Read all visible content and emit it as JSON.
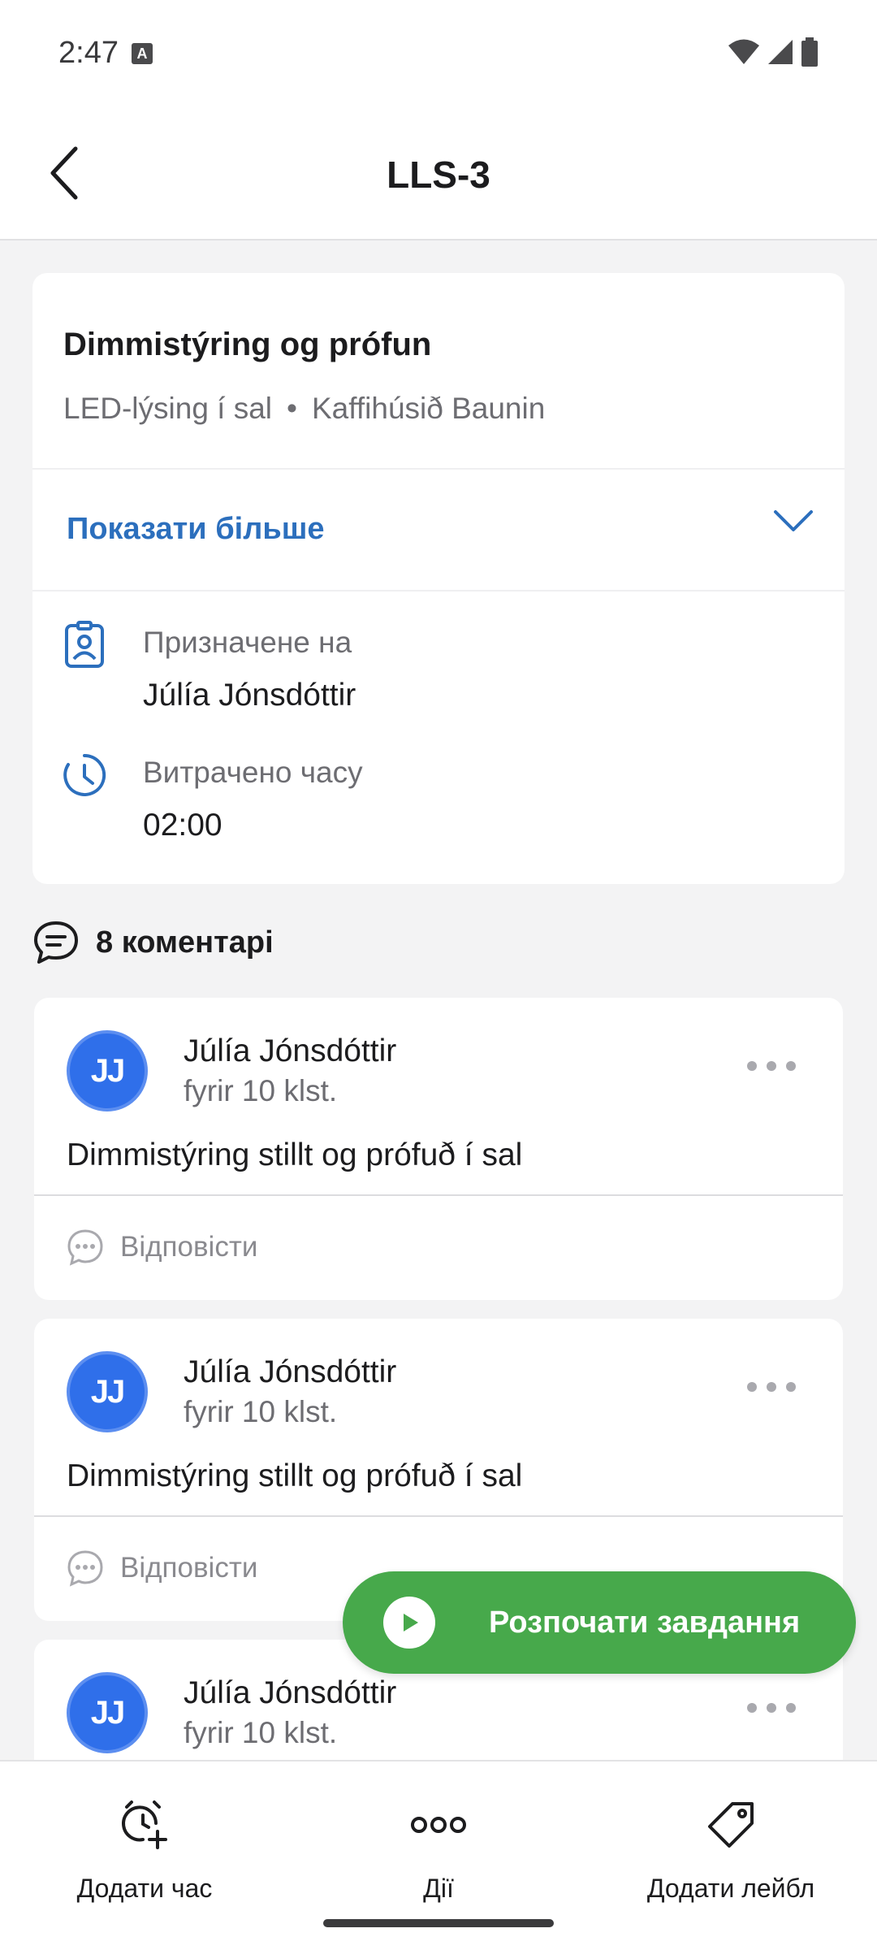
{
  "status_bar": {
    "time": "2:47",
    "notification_icon": "A"
  },
  "header": {
    "title": "LLS-3"
  },
  "task": {
    "title": "Dimmistýring og prófun",
    "category": "LED-lýsing í sal",
    "separator": "•",
    "location": "Kaffihúsið Baunin",
    "show_more": "Показати більше",
    "assigned_label": "Призначене на",
    "assigned_value": "Júlía Jónsdóttir",
    "time_spent_label": "Витрачено часу",
    "time_spent_value": "02:00"
  },
  "comments": {
    "header": "8 коментарі",
    "items": [
      {
        "initials": "JJ",
        "author": "Júlía Jónsdóttir",
        "time": "fyrir 10 klst.",
        "text": "Dimmistýring stillt og prófuð í sal",
        "reply": "Відповісти"
      },
      {
        "initials": "JJ",
        "author": "Júlía Jónsdóttir",
        "time": "fyrir 10 klst.",
        "text": "Dimmistýring stillt og prófuð í sal",
        "reply": "Відповісти"
      },
      {
        "initials": "JJ",
        "author": "Júlía Jónsdóttir",
        "time": "fyrir 10 klst.",
        "text": "",
        "reply": ""
      }
    ]
  },
  "fab": {
    "label": "Розпочати завдання",
    "icon": "play-icon"
  },
  "bottom_bar": {
    "add_time": "Додати час",
    "actions": "Дії",
    "add_label": "Додати лейбл"
  },
  "colors": {
    "accent": "#2c6fbd",
    "avatar": "#2f6fea",
    "fab": "#47a94b"
  }
}
